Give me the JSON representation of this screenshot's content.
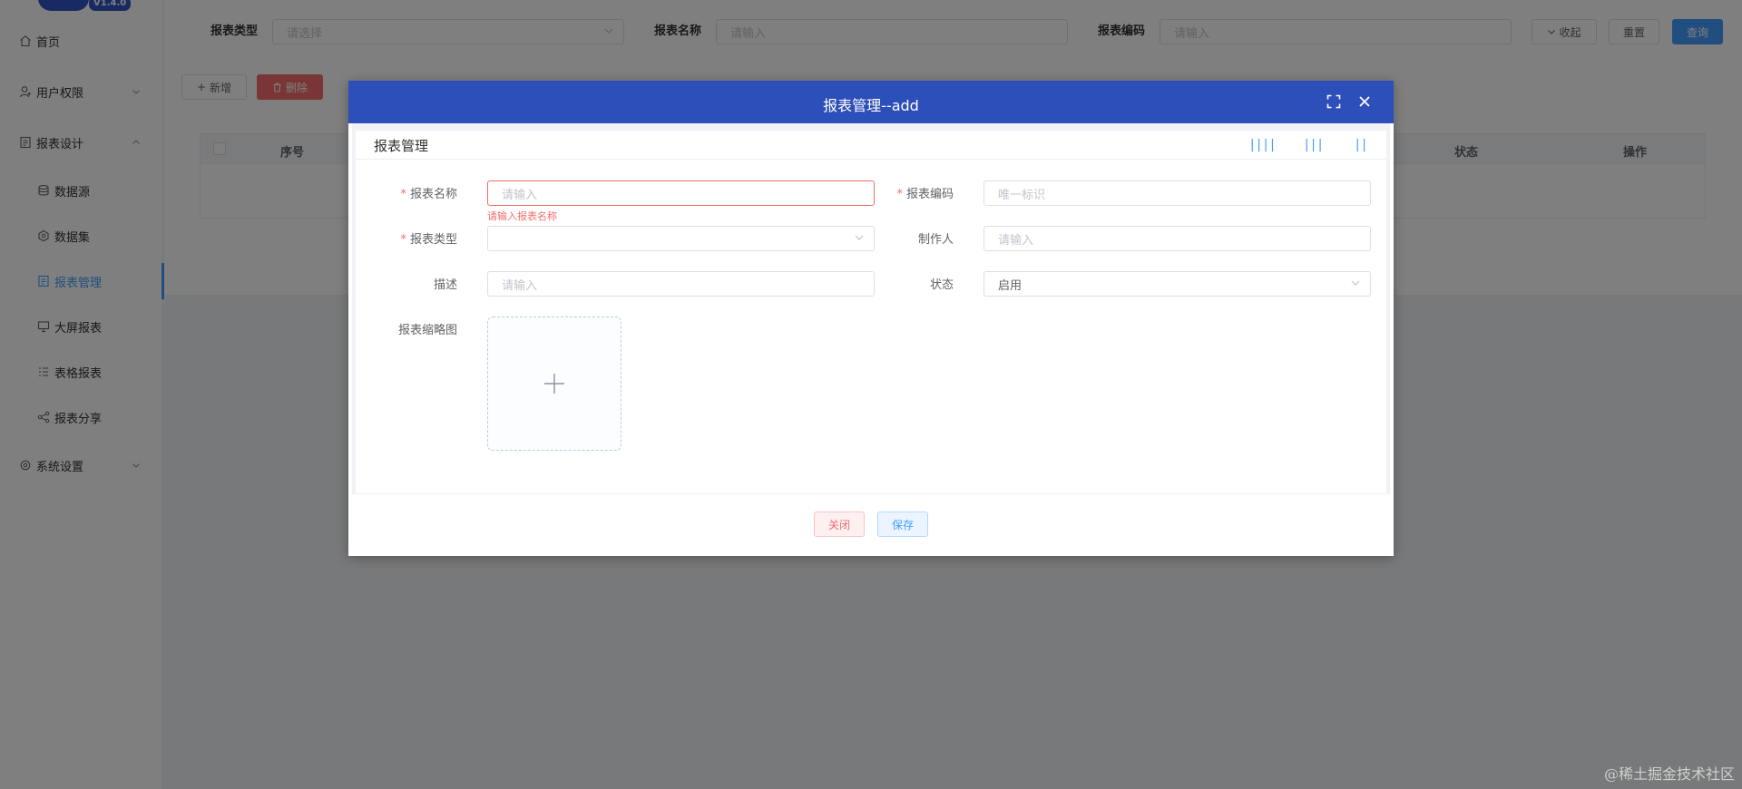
{
  "app": {
    "version": "V1.4.0"
  },
  "sidebar": {
    "items": [
      {
        "label": "首页",
        "icon": "home-icon"
      },
      {
        "label": "用户权限",
        "icon": "user-icon",
        "expanded": false
      },
      {
        "label": "报表设计",
        "icon": "report-design-icon",
        "expanded": true
      },
      {
        "label": "数据源",
        "icon": "database-icon"
      },
      {
        "label": "数据集",
        "icon": "dataset-icon"
      },
      {
        "label": "报表管理",
        "icon": "report-manage-icon",
        "active": true
      },
      {
        "label": "大屏报表",
        "icon": "screen-icon"
      },
      {
        "label": "表格报表",
        "icon": "table-icon"
      },
      {
        "label": "报表分享",
        "icon": "share-icon"
      },
      {
        "label": "系统设置",
        "icon": "settings-icon",
        "expanded": false
      }
    ]
  },
  "filters": {
    "report_type_label": "报表类型",
    "report_type_placeholder": "请选择",
    "report_name_label": "报表名称",
    "report_name_placeholder": "请输入",
    "report_code_label": "报表编码",
    "report_code_placeholder": "请输入",
    "collapse_label": "收起",
    "reset_label": "重置",
    "query_label": "查询"
  },
  "toolbar": {
    "add_label": "新增",
    "delete_label": "删除"
  },
  "table": {
    "columns": [
      "序号",
      "状态",
      "操作"
    ]
  },
  "dialog": {
    "title": "报表管理--add",
    "card_title": "报表管理",
    "density_icons": [
      "||||",
      "|||",
      "||"
    ],
    "form": {
      "report_name": {
        "label": "报表名称",
        "placeholder": "请输入",
        "required": true,
        "error": "请输入报表名称"
      },
      "report_code": {
        "label": "报表编码",
        "placeholder": "唯一标识",
        "required": true
      },
      "report_type": {
        "label": "报表类型",
        "value": "",
        "required": true
      },
      "author": {
        "label": "制作人",
        "placeholder": "请输入"
      },
      "description": {
        "label": "描述",
        "placeholder": "请输入"
      },
      "status": {
        "label": "状态",
        "value": "启用"
      },
      "thumbnail": {
        "label": "报表缩略图"
      }
    },
    "close_label": "关闭",
    "save_label": "保存"
  },
  "watermark": "@稀土掘金技术社区",
  "colors": {
    "primary": "#409eff",
    "danger": "#f56c6c",
    "dialog_header": "#2d4fb9"
  }
}
